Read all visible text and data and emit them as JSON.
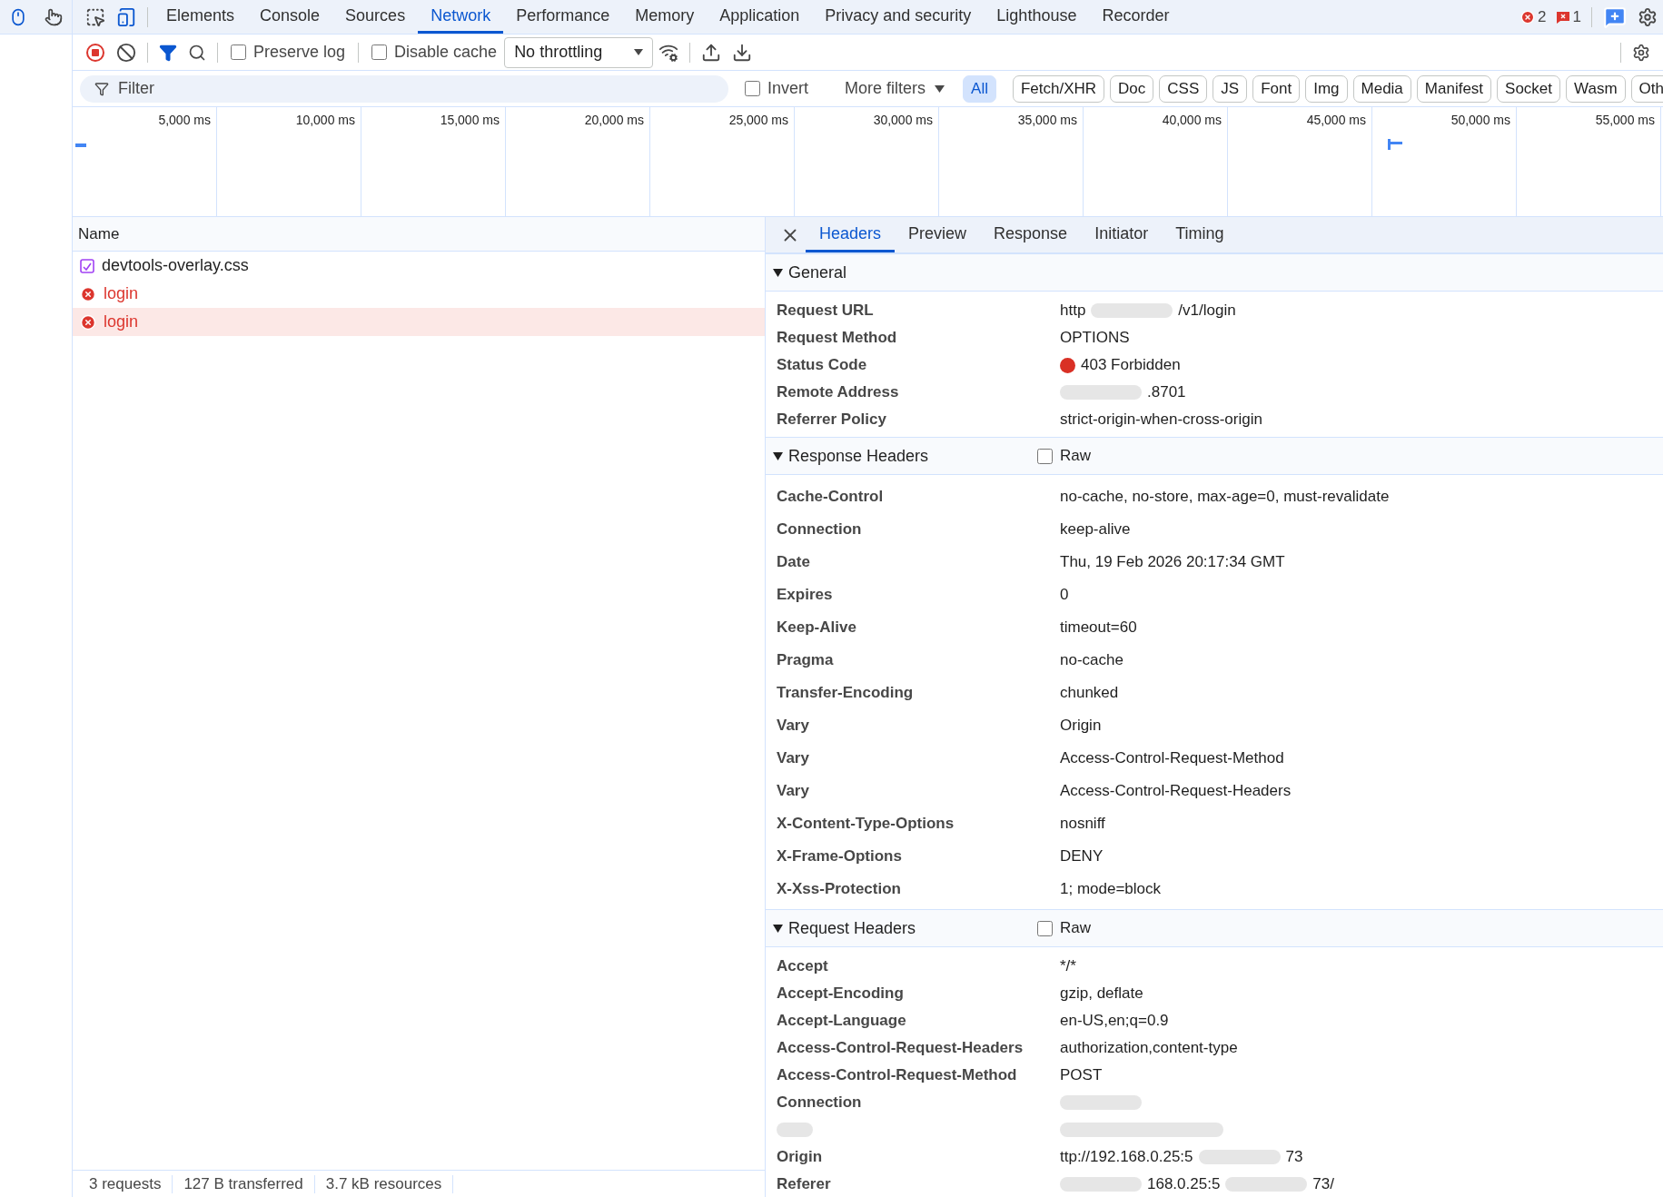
{
  "main_tabs": [
    {
      "label": "Elements",
      "selected": false
    },
    {
      "label": "Console",
      "selected": false
    },
    {
      "label": "Sources",
      "selected": false
    },
    {
      "label": "Network",
      "selected": true
    },
    {
      "label": "Performance",
      "selected": false
    },
    {
      "label": "Memory",
      "selected": false
    },
    {
      "label": "Application",
      "selected": false
    },
    {
      "label": "Privacy and security",
      "selected": false
    },
    {
      "label": "Lighthouse",
      "selected": false
    },
    {
      "label": "Recorder",
      "selected": false
    }
  ],
  "error_count": "2",
  "issue_count": "1",
  "toolbar": {
    "recording": true,
    "preserve_log": {
      "label": "Preserve log",
      "checked": false
    },
    "disable_cache": {
      "label": "Disable cache",
      "checked": false
    },
    "throttling": "No throttling"
  },
  "filter": {
    "placeholder": "Filter"
  },
  "invert": {
    "label": "Invert",
    "checked": false
  },
  "more_filters": "More filters",
  "type_filters": [
    {
      "label": "All",
      "selected": true
    },
    {
      "label": "Fetch/XHR",
      "selected": false
    },
    {
      "label": "Doc",
      "selected": false
    },
    {
      "label": "CSS",
      "selected": false
    },
    {
      "label": "JS",
      "selected": false
    },
    {
      "label": "Font",
      "selected": false
    },
    {
      "label": "Img",
      "selected": false
    },
    {
      "label": "Media",
      "selected": false
    },
    {
      "label": "Manifest",
      "selected": false
    },
    {
      "label": "Socket",
      "selected": false
    },
    {
      "label": "Wasm",
      "selected": false
    },
    {
      "label": "Oth",
      "selected": false
    }
  ],
  "timeline_ticks": [
    "5,000 ms",
    "10,000 ms",
    "15,000 ms",
    "20,000 ms",
    "25,000 ms",
    "30,000 ms",
    "35,000 ms",
    "40,000 ms",
    "45,000 ms",
    "50,000 ms",
    "55,000 ms"
  ],
  "requests_column": "Name",
  "requests": [
    {
      "name": "devtools-overlay.css",
      "failed": false,
      "selected": false
    },
    {
      "name": "login",
      "failed": true,
      "selected": false
    },
    {
      "name": "login",
      "failed": true,
      "selected": true
    }
  ],
  "detail_tabs": [
    {
      "label": "Headers",
      "selected": true
    },
    {
      "label": "Preview",
      "selected": false
    },
    {
      "label": "Response",
      "selected": false
    },
    {
      "label": "Initiator",
      "selected": false
    },
    {
      "label": "Timing",
      "selected": false
    }
  ],
  "sections": [
    {
      "title": "General",
      "expanded": true,
      "rows": [
        {
          "kind": "smudged",
          "key": "Request URL",
          "parts": [
            {
              "kind": "text",
              "text": "http"
            },
            {
              "kind": "smudge"
            },
            {
              "kind": "text",
              "text": "/v1/login"
            }
          ]
        },
        {
          "kind": "plain",
          "key": "Request Method",
          "value": "OPTIONS"
        },
        {
          "kind": "status",
          "key": "Status Code",
          "value": "403 Forbidden",
          "color": "#d93025"
        },
        {
          "kind": "smudged",
          "key": "Remote Address",
          "parts": [
            {
              "kind": "smudge"
            },
            {
              "kind": "text",
              "text": ".8701"
            }
          ]
        },
        {
          "kind": "plain",
          "key": "Referrer Policy",
          "value": "strict-origin-when-cross-origin"
        }
      ]
    },
    {
      "title": "Response Headers",
      "expanded": true,
      "raw": {
        "label": "Raw",
        "checked": false
      },
      "rows": [
        {
          "kind": "plain",
          "key": "Cache-Control",
          "value": "no-cache, no-store, max-age=0, must-revalidate"
        },
        {
          "kind": "plain",
          "key": "Connection",
          "value": "keep-alive"
        },
        {
          "kind": "plain",
          "key": "Date",
          "value": "Thu, 19 Feb 2026 20:17:34 GMT"
        },
        {
          "kind": "plain",
          "key": "Expires",
          "value": "0"
        },
        {
          "kind": "plain",
          "key": "Keep-Alive",
          "value": "timeout=60"
        },
        {
          "kind": "plain",
          "key": "Pragma",
          "value": "no-cache"
        },
        {
          "kind": "plain",
          "key": "Transfer-Encoding",
          "value": "chunked"
        },
        {
          "kind": "plain",
          "key": "Vary",
          "value": "Origin"
        },
        {
          "kind": "plain",
          "key": "Vary",
          "value": "Access-Control-Request-Method"
        },
        {
          "kind": "plain",
          "key": "Vary",
          "value": "Access-Control-Request-Headers"
        },
        {
          "kind": "plain",
          "key": "X-Content-Type-Options",
          "value": "nosniff"
        },
        {
          "kind": "plain",
          "key": "X-Frame-Options",
          "value": "DENY"
        },
        {
          "kind": "plain",
          "key": "X-Xss-Protection",
          "value": "1; mode=block"
        }
      ]
    },
    {
      "title": "Request Headers",
      "expanded": true,
      "raw": {
        "label": "Raw",
        "checked": false
      },
      "rows": [
        {
          "kind": "plain",
          "key": "Accept",
          "value": "*/*"
        },
        {
          "kind": "plain",
          "key": "Accept-Encoding",
          "value": "gzip, deflate"
        },
        {
          "kind": "plain",
          "key": "Accept-Language",
          "value": "en-US,en;q=0.9"
        },
        {
          "kind": "plain",
          "key": "Access-Control-Request-Headers",
          "value": "authorization,content-type"
        },
        {
          "kind": "plain",
          "key": "Access-Control-Request-Method",
          "value": "POST"
        },
        {
          "kind": "smudged",
          "key": "Connection",
          "parts": [
            {
              "kind": "smudge"
            }
          ]
        },
        {
          "kind": "hidden"
        },
        {
          "kind": "smudged",
          "key": "Origin",
          "parts": [
            {
              "kind": "text",
              "text": "ttp://192.168.0.25:5"
            },
            {
              "kind": "smudge"
            },
            {
              "kind": "text",
              "text": "73"
            }
          ]
        },
        {
          "kind": "smudged",
          "key": "Referer",
          "parts": [
            {
              "kind": "smudge"
            },
            {
              "kind": "text",
              "text": "168.0.25:5"
            },
            {
              "kind": "smudge"
            },
            {
              "kind": "text",
              "text": "73/"
            }
          ]
        }
      ]
    }
  ],
  "status_bar": [
    "3 requests",
    "127 B transferred",
    "3.7 kB resources"
  ]
}
